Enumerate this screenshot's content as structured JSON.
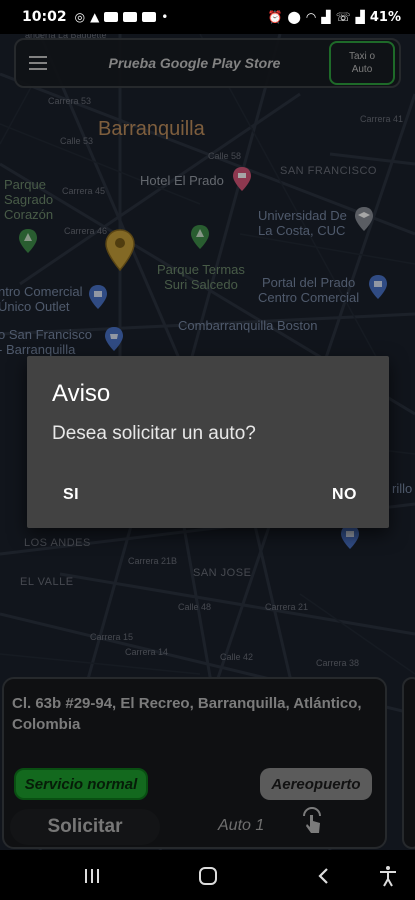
{
  "status_bar": {
    "time": "10:02",
    "left_icons": [
      "whatsapp-icon",
      "warning-icon",
      "youtube-icon",
      "youtube-icon",
      "youtube-icon",
      "dot-icon"
    ],
    "right_icons": [
      "alarm-icon",
      "location-icon",
      "wifi-icon",
      "signal-icon",
      "volte-icon",
      "signal-icon"
    ],
    "battery": "41%"
  },
  "map": {
    "city": "Barranquilla",
    "labels": {
      "hotel": "Hotel El Prado",
      "universidad": "Universidad De\nLa Costa, CUC",
      "parque_sagrado": "Parque\nSagrado\nCorazón",
      "parque_termas": "Parque Termas\nSuri Salcedo",
      "centro_unico": "ntro Comercial\nÚnico Outlet",
      "portal_prado": "Portal del Prado\nCentro Comercial",
      "combarranquilla": "Combarranquilla Boston",
      "san_francisco_poi": "o San Francisco\n- Barranquilla",
      "san_francisco_area": "SAN FRANCISCO",
      "los_andes": "LOS ANDES",
      "el_valle": "EL VALLE",
      "san_jose": "SAN JOSE",
      "rillo": "rillo",
      "top_cut": "andería La Baguette"
    },
    "roads": {
      "carrera_53": "Carrera 53",
      "calle_53": "Calle 53",
      "carrera_45": "Carrera 45",
      "carrera_46": "Carrera 46",
      "carrera_41": "Carrera 41",
      "carrera_38": "Carrera 38",
      "carrera_21b": "Carrera 21B",
      "carrera_15": "Carrera 15",
      "carrera_14": "Carrera 14",
      "carrera_21": "Carrera 21",
      "calle_58": "Calle 58",
      "calle_48": "Calle 48",
      "calle_42": "Calle 42"
    }
  },
  "top_bar": {
    "title": "Prueba Google Play Store",
    "taxi_button": "Taxi o\nAuto"
  },
  "bottom_panel": {
    "address": "Cl. 63b #29-94, El Recreo, Barranquilla, Atlántico, Colombia",
    "service_normal": "Servicio normal",
    "aeropuerto": "Aereopuerto",
    "solicitar": "Solicitar",
    "auto_label": "Auto 1"
  },
  "dialog": {
    "title": "Aviso",
    "message": "Desea solicitar un auto?",
    "positive": "SI",
    "negative": "NO"
  },
  "nav_bar": {
    "items": [
      "recents-icon",
      "home-icon",
      "back-icon",
      "accessibility-icon"
    ]
  }
}
